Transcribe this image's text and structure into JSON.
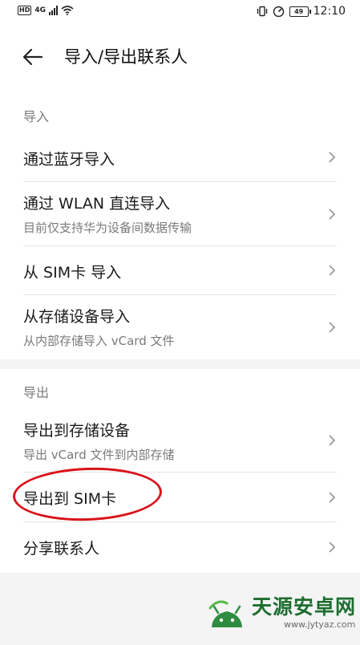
{
  "status_bar": {
    "hd": "HD",
    "network": "4G",
    "battery": "49",
    "time": "12:10"
  },
  "header": {
    "title": "导入/导出联系人"
  },
  "import_section": {
    "label": "导入",
    "items": [
      {
        "main": "通过蓝牙导入"
      },
      {
        "main": "通过 WLAN 直连导入",
        "sub": "目前仅支持华为设备间数据传输"
      },
      {
        "main": "从 SIM卡 导入"
      },
      {
        "main": "从存储设备导入",
        "sub": "从内部存储导入 vCard 文件"
      }
    ]
  },
  "export_section": {
    "label": "导出",
    "items": [
      {
        "main": "导出到存储设备",
        "sub": "导出 vCard 文件到内部存储"
      },
      {
        "main": "导出到 SIM卡"
      },
      {
        "main": "分享联系人"
      }
    ]
  },
  "watermark": {
    "title": "天源安卓网",
    "url": "www.jytyaz.com"
  },
  "colors": {
    "highlight": "#d9141b",
    "watermark_green": "#1d6d2f"
  }
}
